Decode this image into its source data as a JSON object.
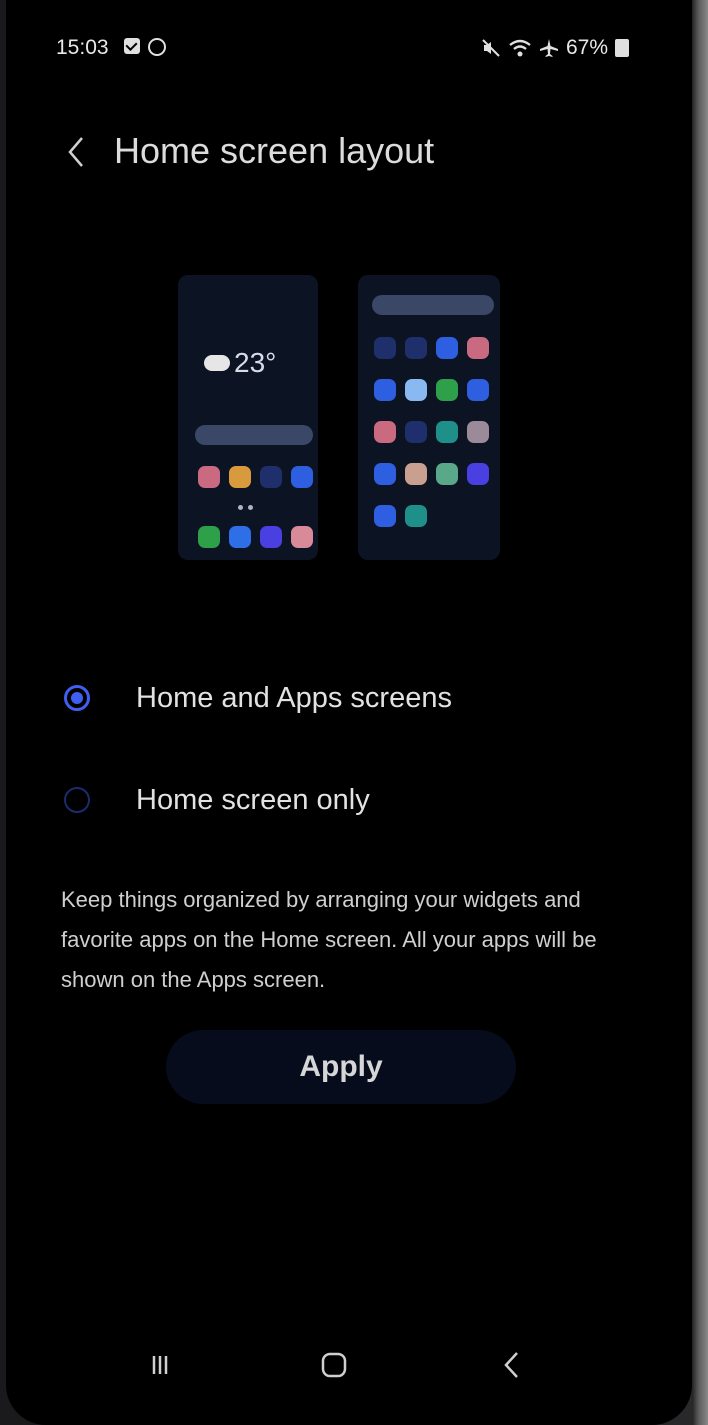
{
  "status_bar": {
    "time": "15:03",
    "battery": "67%",
    "left_icons": [
      "checkbox-icon",
      "clock-icon"
    ],
    "right_icons": [
      "mute-icon",
      "wifi-icon",
      "airplane-icon",
      "battery-icon"
    ]
  },
  "header": {
    "title": "Home screen layout",
    "back_icon": "chevron-left-icon"
  },
  "preview": {
    "weather_temp": "23°",
    "home_icon_colors": [
      "#c96a80",
      "#d89a3c",
      "#1e2f6c",
      "#2e5fe0",
      "#2ea04a",
      "#2e6fe8",
      "#4a3fe0",
      "#d88a98"
    ],
    "apps_icon_colors": [
      "#1e2f6c",
      "#1e2f6c",
      "#2e5fe0",
      "#c96a80",
      "#2e5fe0",
      "#8ab8f0",
      "#2ea04a",
      "#2e5fe0",
      "#c96a80",
      "#1e2f6c",
      "#1f8f8a",
      "#9a8a9a",
      "#2e5fe0",
      "#c9a090",
      "#5aa88a",
      "#4a3fe0",
      "#2e5fe0",
      "#1f8f8a"
    ]
  },
  "options": [
    {
      "label": "Home and Apps screens",
      "selected": true
    },
    {
      "label": "Home screen only",
      "selected": false
    }
  ],
  "description": "Keep things organized by arranging your widgets and favorite apps on the Home screen. All your apps will be shown on the Apps screen.",
  "apply_label": "Apply",
  "navbar": {
    "recents_icon": "recents-icon",
    "home_icon": "home-icon",
    "back_icon": "back-icon"
  },
  "colors": {
    "accent": "#3f5ff0",
    "background": "#000000",
    "text": "#e2e2e2"
  }
}
